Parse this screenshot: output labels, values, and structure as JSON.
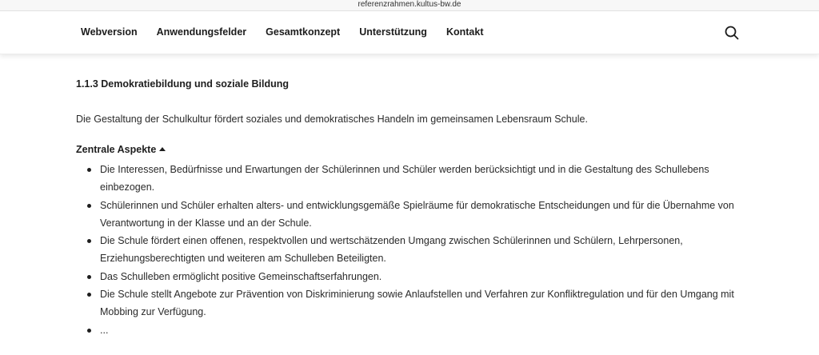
{
  "browser": {
    "url": "referenzrahmen.kultus-bw.de"
  },
  "nav": {
    "items": [
      "Webversion",
      "Anwendungsfelder",
      "Gesamtkonzept",
      "Unterstützung",
      "Kontakt"
    ],
    "search_icon": "search-icon"
  },
  "section": {
    "title": "1.1.3 Demokratiebildung und soziale Bildung",
    "intro": "Die Gestaltung der Schulkultur fördert soziales und demokratisches Handeln im gemeinsamen Lebensraum Schule.",
    "aspects_label": "Zentrale Aspekte",
    "aspects": [
      "Die Interessen, Bedürfnisse und Erwartungen der Schülerinnen und Schüler werden berücksichtigt und in die Gestaltung des Schullebens einbezogen.",
      "Schülerinnen und Schüler erhalten alters- und entwicklungsgemäße Spielräume für demokratische Entscheidungen und für die Übernahme von Verantwortung in der Klasse und an der Schule.",
      "Die Schule fördert einen offenen, respektvollen und wertschätzenden Umgang zwischen Schülerinnen und Schülern, Lehrpersonen, Erziehungsberechtigten und weiteren am Schulleben Beteiligten.",
      "Das Schulleben ermöglicht positive Gemeinschaftserfahrungen.",
      "Die Schule stellt Angebote zur Prävention von Diskriminierung sowie Anlaufstellen und Verfahren zur Konfliktregulation und für den Umgang mit Mobbing zur Verfügung.",
      "..."
    ]
  }
}
